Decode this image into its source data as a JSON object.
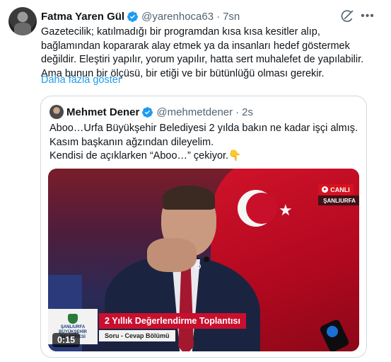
{
  "post": {
    "author_name": "Fatma Yaren Gül",
    "author_handle": "@yarenhoca63",
    "separator": "·",
    "time": "7sn",
    "text": "Gazetecilik; katılmadığı bir programdan kısa kısa kesitler alıp, bağlamından kopararak alay etmek ya da insanları hedef göstermek değildir. Eleştiri yapılır, yorum yapılır, hatta sert muhalefet de yapılabilir. Ama bunun bir ölçüsü, bir etiği ve bir bütünlüğü olması gerekir.",
    "show_more": "Daha fazla göster"
  },
  "quote": {
    "author_name": "Mehmet Dener",
    "author_handle": "@mehmetdener",
    "separator": "·",
    "time": "2s",
    "line1": "Aboo…Urfa Büyükşehir Belediyesi 2 yılda bakın ne kadar işçi almış.",
    "line2": "Kasım başkanın ağzından dileyelim.",
    "line3": "Kendisi de açıklarken “Aboo…” çekiyor.👇"
  },
  "video": {
    "live_badge": "CANLI",
    "city_badge": "ŞANLIURFA",
    "lower_title": "2 Yıllık Değerlendirme Toplantısı",
    "lower_subtitle": "Soru - Cevap Bölümü",
    "logo_line1": "ŞANLIURFA",
    "logo_line2": "BÜYÜKŞEHİR",
    "logo_line3": "BELEDİYESİ",
    "duration": "0:15"
  },
  "colors": {
    "link": "#1d9bf0",
    "verified": "#1d9bf0",
    "secondary_text": "#536471",
    "border": "#cfd9de"
  },
  "icons": {
    "verified": "verified-badge-icon",
    "grok": "grok-icon",
    "more": "more-horizontal-icon"
  }
}
